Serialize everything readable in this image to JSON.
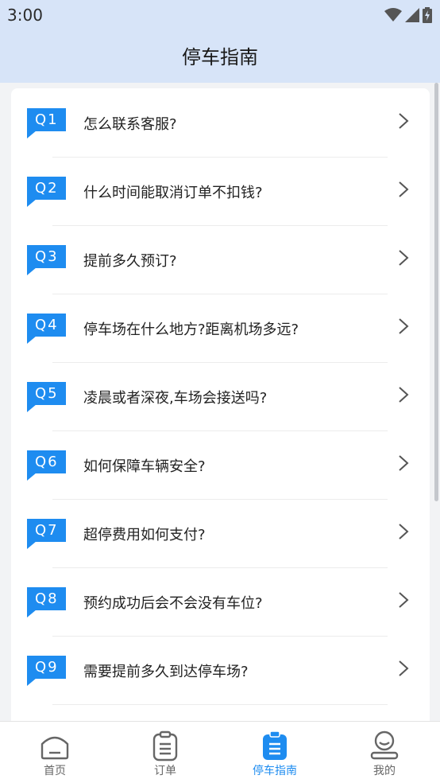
{
  "status_bar": {
    "time": "3:00",
    "icons": [
      "wifi-icon",
      "signal-icon",
      "battery-charging-icon"
    ]
  },
  "header": {
    "title": "停车指南"
  },
  "faq": [
    {
      "badge": "Q1",
      "question": "怎么联系客服?"
    },
    {
      "badge": "Q2",
      "question": "什么时间能取消订单不扣钱?"
    },
    {
      "badge": "Q3",
      "question": "提前多久预订?"
    },
    {
      "badge": "Q4",
      "question": "停车场在什么地方?距离机场多远?"
    },
    {
      "badge": "Q5",
      "question": "凌晨或者深夜,车场会接送吗?"
    },
    {
      "badge": "Q6",
      "question": "如何保障车辆安全?"
    },
    {
      "badge": "Q7",
      "question": "超停费用如何支付?"
    },
    {
      "badge": "Q8",
      "question": "预约成功后会不会没有车位?"
    },
    {
      "badge": "Q9",
      "question": "需要提前多久到达停车场?"
    }
  ],
  "bottom_nav": [
    {
      "label": "首页",
      "icon": "home-icon",
      "active": false
    },
    {
      "label": "订单",
      "icon": "clipboard-icon",
      "active": false
    },
    {
      "label": "停车指南",
      "icon": "guide-icon",
      "active": true
    },
    {
      "label": "我的",
      "icon": "user-icon",
      "active": false
    }
  ],
  "colors": {
    "header_bg": "#d7e4f8",
    "accent": "#1e8cf0",
    "page_bg": "#f2f3f5",
    "inactive": "#666666"
  }
}
